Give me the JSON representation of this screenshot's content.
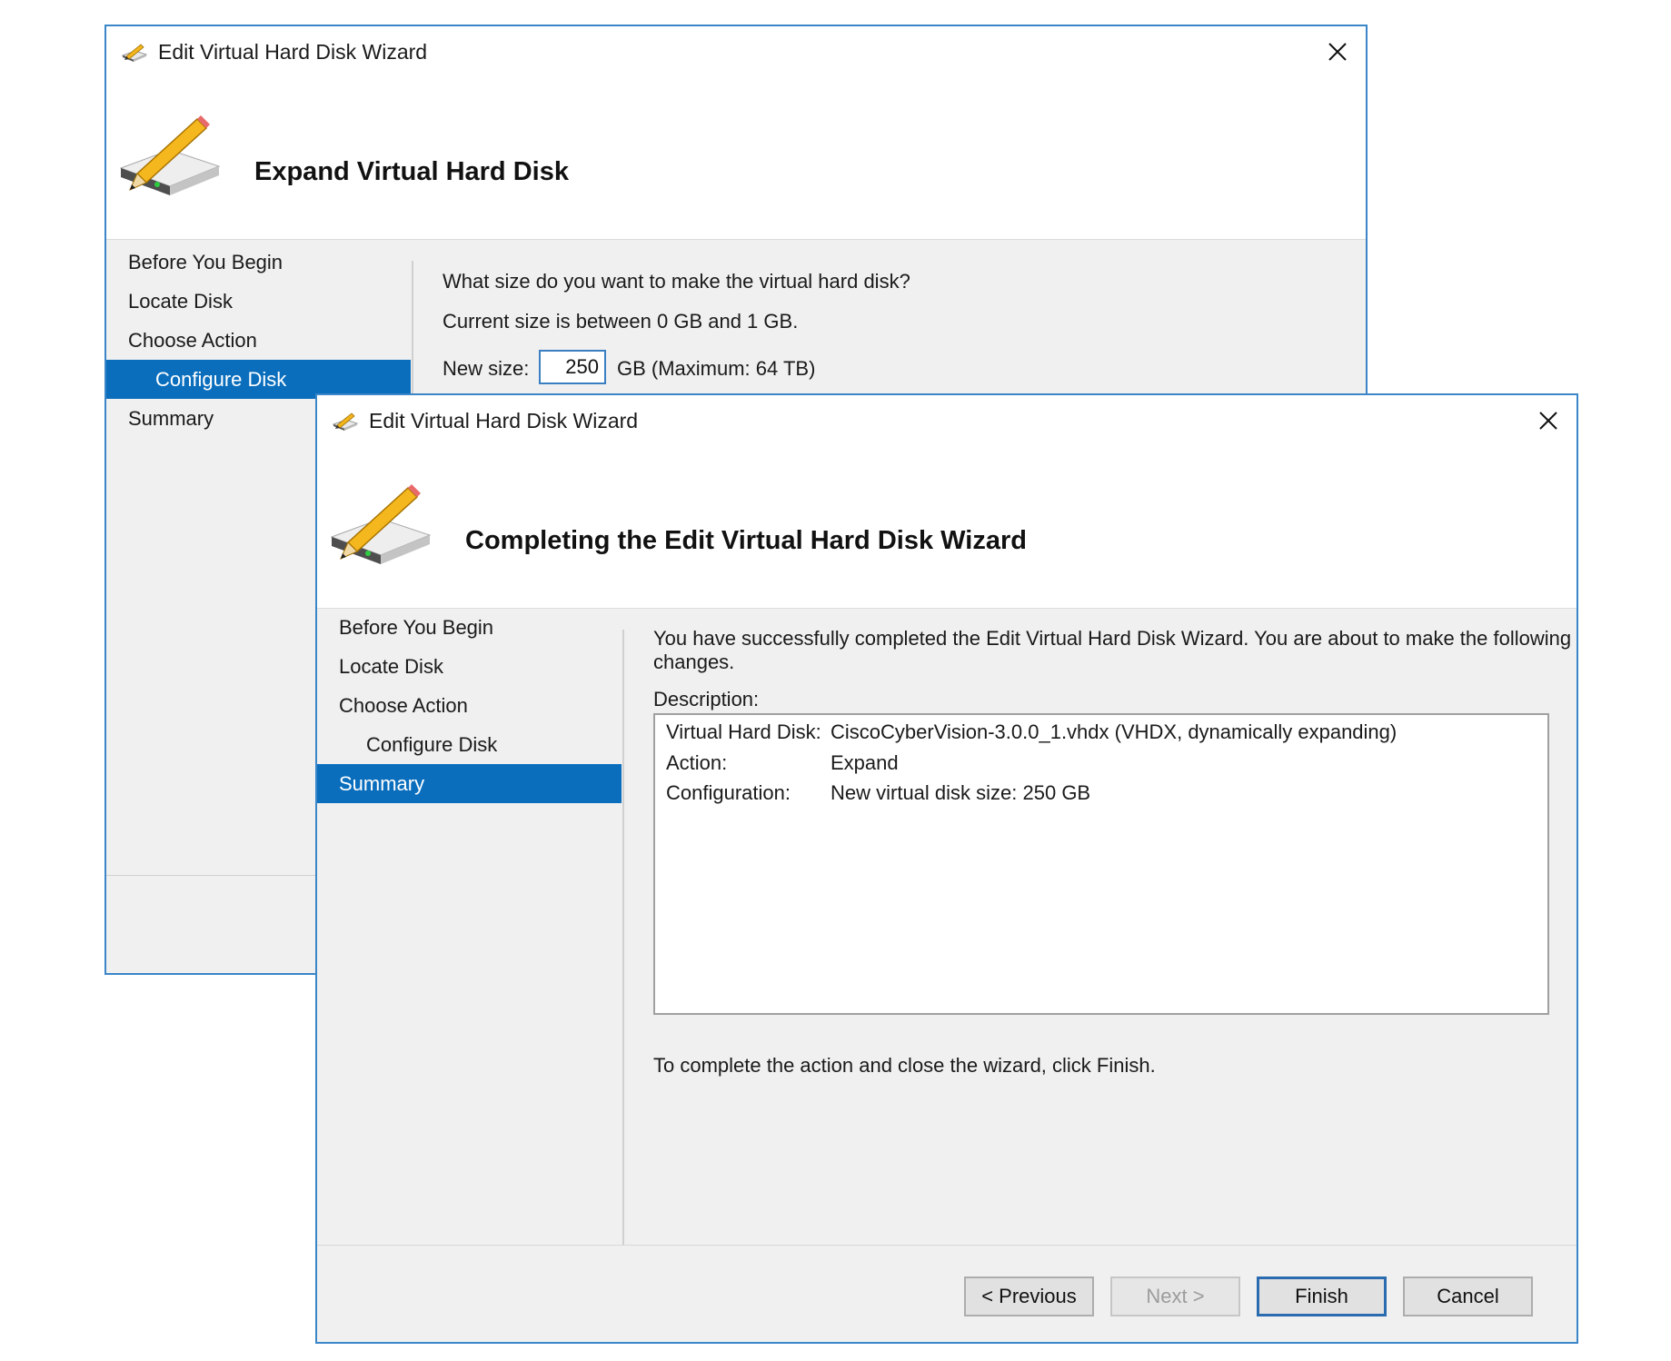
{
  "back_window": {
    "title": "Edit Virtual Hard Disk Wizard",
    "header": "Expand Virtual Hard Disk",
    "nav": [
      {
        "label": "Before You Begin",
        "active": false
      },
      {
        "label": "Locate Disk",
        "active": false
      },
      {
        "label": "Choose Action",
        "active": false
      },
      {
        "label": "Configure Disk",
        "active": true
      },
      {
        "label": "Summary",
        "active": false
      }
    ],
    "question": "What size do you want to make the virtual hard disk?",
    "current_size": "Current size is between 0 GB and 1 GB.",
    "new_size_label": "New size:",
    "new_size_value": "250",
    "size_suffix": "GB (Maximum: 64 TB)"
  },
  "front_window": {
    "title": "Edit Virtual Hard Disk Wizard",
    "header": "Completing the Edit Virtual Hard Disk Wizard",
    "nav": [
      {
        "label": "Before You Begin",
        "active": false
      },
      {
        "label": "Locate Disk",
        "active": false
      },
      {
        "label": "Choose Action",
        "active": false
      },
      {
        "label": "Configure Disk",
        "active": false
      },
      {
        "label": "Summary",
        "active": true
      }
    ],
    "intro_line1": "You have successfully completed the Edit Virtual Hard Disk Wizard. You are about to make the following",
    "intro_line2": "changes.",
    "description_label": "Description:",
    "description": [
      {
        "key": "Virtual Hard Disk:",
        "value": "CiscoCyberVision-3.0.0_1.vhdx (VHDX, dynamically expanding)"
      },
      {
        "key": "Action:",
        "value": "Expand"
      },
      {
        "key": "Configuration:",
        "value": "New virtual disk size: 250 GB"
      }
    ],
    "finish_hint": "To complete the action and close the wizard, click Finish.",
    "buttons": {
      "previous": "< Previous",
      "next": "Next >",
      "finish": "Finish",
      "cancel": "Cancel"
    }
  },
  "icons": {
    "title_icon": "disk-pencil-icon",
    "header_icon": "disk-pencil-icon",
    "close": "close-icon"
  },
  "colors": {
    "accent": "#0a6ebd",
    "window_border": "#3a86c8",
    "dialog_bg": "#f0f0f0"
  }
}
